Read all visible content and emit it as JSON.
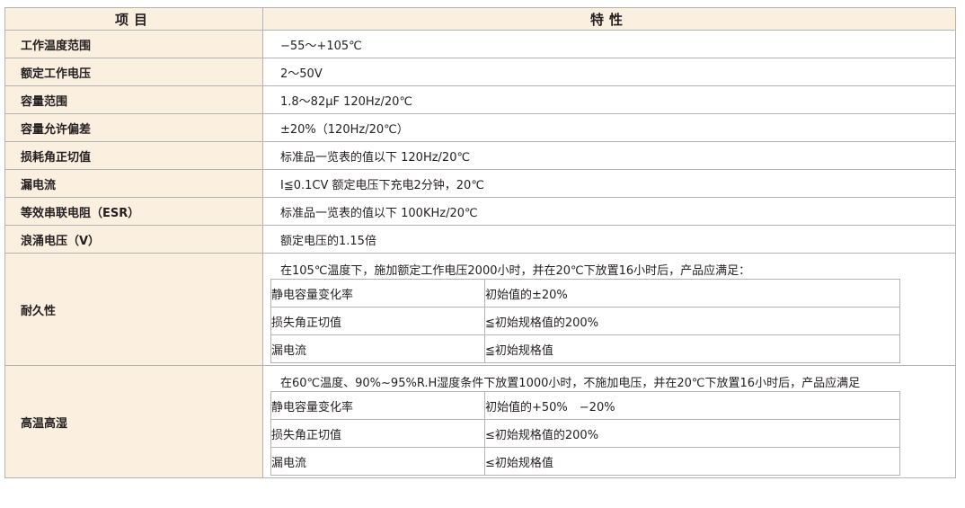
{
  "header": {
    "col_item": "项目",
    "col_spec": "特性"
  },
  "rows": [
    {
      "label": "工作温度范围",
      "value": "−55～+105℃"
    },
    {
      "label": "额定工作电压",
      "value": "2～50V"
    },
    {
      "label": "容量范围",
      "value": "1.8～82μF  120Hz/20℃"
    },
    {
      "label": "容量允许偏差",
      "value": "±20%（120Hz/20℃）"
    },
    {
      "label": "损耗角正切值",
      "value": "标准品一览表的值以下  120Hz/20℃"
    },
    {
      "label": "漏电流",
      "value": "I≦0.1CV 额定电压下充电2分钟，20℃"
    },
    {
      "label": "等效串联电阻（ESR）",
      "value": "标准品一览表的值以下  100KHz/20℃"
    },
    {
      "label": "浪涌电压（V）",
      "value": "额定电压的1.15倍"
    }
  ],
  "groups": [
    {
      "label": "耐久性",
      "caption": "在105℃温度下，施加额定工作电压2000小时，并在20℃下放置16小时后，产品应满足：",
      "items": [
        {
          "name": "静电容量变化率",
          "value": "初始值的±20%"
        },
        {
          "name": "损失角正切值",
          "value": "≦初始规格值的200%"
        },
        {
          "name": "漏电流",
          "value": "≦初始规格值"
        }
      ]
    },
    {
      "label": "高温高湿",
      "caption": "在60℃温度、90%~95%R.H湿度条件下放置1000小时，不施加电压，并在20℃下放置16小时后，产品应满足",
      "items": [
        {
          "name": "静电容量变化率",
          "value": "初始值的+50%　−20%"
        },
        {
          "name": "损失角正切值",
          "value": "≤初始规格值的200%"
        },
        {
          "name": "漏电流",
          "value": "≤初始规格值"
        }
      ]
    }
  ]
}
